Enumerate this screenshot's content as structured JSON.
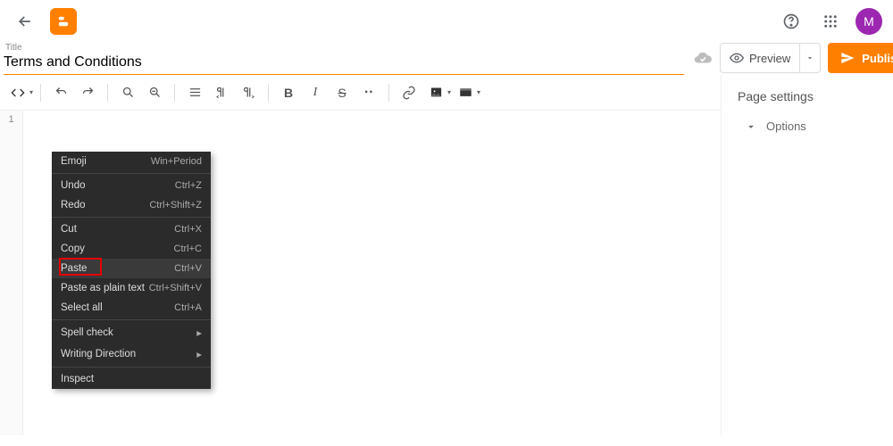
{
  "header": {
    "avatar_letter": "M"
  },
  "title": {
    "label": "Title",
    "value": "Terms and Conditions"
  },
  "actions": {
    "preview_label": "Preview",
    "publish_label": "Publish"
  },
  "sidebar": {
    "title": "Page settings",
    "options_label": "Options"
  },
  "editor": {
    "line_number": "1"
  },
  "context_menu": {
    "items": [
      {
        "label": "Emoji",
        "shortcut": "Win+Period",
        "sep_after": true
      },
      {
        "label": "Undo",
        "shortcut": "Ctrl+Z"
      },
      {
        "label": "Redo",
        "shortcut": "Ctrl+Shift+Z",
        "sep_after": true
      },
      {
        "label": "Cut",
        "shortcut": "Ctrl+X"
      },
      {
        "label": "Copy",
        "shortcut": "Ctrl+C"
      },
      {
        "label": "Paste",
        "shortcut": "Ctrl+V",
        "highlighted": true,
        "hovered": true
      },
      {
        "label": "Paste as plain text",
        "shortcut": "Ctrl+Shift+V"
      },
      {
        "label": "Select all",
        "shortcut": "Ctrl+A",
        "sep_after": true
      },
      {
        "label": "Spell check",
        "submenu": true
      },
      {
        "label": "Writing Direction",
        "submenu": true,
        "sep_after": true
      },
      {
        "label": "Inspect"
      }
    ]
  }
}
